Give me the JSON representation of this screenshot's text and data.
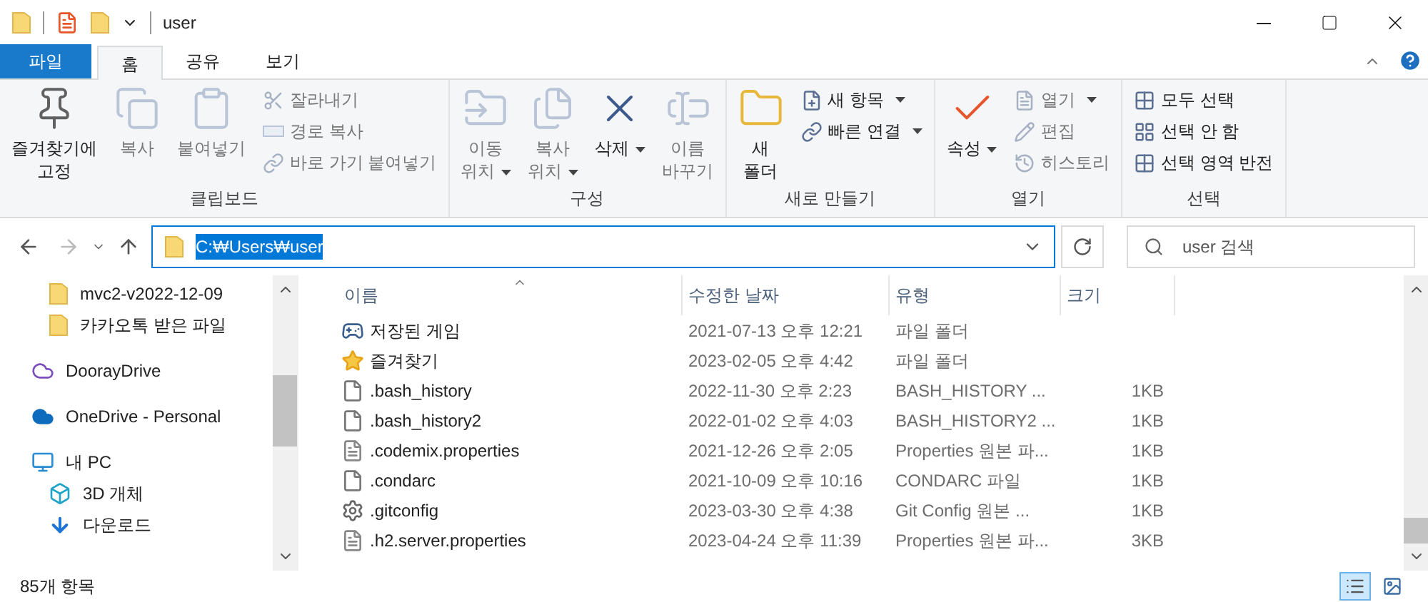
{
  "window": {
    "title": "user"
  },
  "ribbon_tabs": [
    {
      "label": "파일",
      "kind": "file",
      "selected": false
    },
    {
      "label": "홈",
      "kind": "tab",
      "selected": true
    },
    {
      "label": "공유",
      "kind": "tab",
      "selected": false
    },
    {
      "label": "보기",
      "kind": "tab",
      "selected": false
    }
  ],
  "ribbon_groups": [
    {
      "label": "클립보드",
      "items": [
        {
          "kind": "large",
          "lines": [
            "즐겨찾기에",
            "고정"
          ],
          "disabled": false,
          "dropdown": false
        },
        {
          "kind": "large",
          "lines": [
            "복사"
          ],
          "disabled": true,
          "dropdown": false
        },
        {
          "kind": "large",
          "lines": [
            "붙여넣기"
          ],
          "disabled": true,
          "dropdown": false
        },
        {
          "kind": "stack",
          "items": [
            {
              "label": "잘라내기",
              "disabled": true,
              "dropdown": false
            },
            {
              "label": "경로 복사",
              "disabled": true,
              "dropdown": false
            },
            {
              "label": "바로 가기 붙여넣기",
              "disabled": true,
              "dropdown": false
            }
          ]
        }
      ]
    },
    {
      "label": "구성",
      "items": [
        {
          "kind": "large",
          "lines": [
            "이동",
            "위치"
          ],
          "disabled": true,
          "dropdown": true
        },
        {
          "kind": "large",
          "lines": [
            "복사",
            "위치"
          ],
          "disabled": true,
          "dropdown": true
        },
        {
          "kind": "large",
          "lines": [
            "삭제"
          ],
          "disabled": false,
          "dropdown": true
        },
        {
          "kind": "large",
          "lines": [
            "이름",
            "바꾸기"
          ],
          "disabled": true,
          "dropdown": false
        }
      ]
    },
    {
      "label": "새로 만들기",
      "items": [
        {
          "kind": "large",
          "lines": [
            "새",
            "폴더"
          ],
          "disabled": false,
          "dropdown": false
        },
        {
          "kind": "stack",
          "items": [
            {
              "label": "새 항목",
              "disabled": false,
              "dropdown": true
            },
            {
              "label": "빠른 연결",
              "disabled": false,
              "dropdown": true
            }
          ]
        }
      ]
    },
    {
      "label": "열기",
      "items": [
        {
          "kind": "large",
          "lines": [
            "속성"
          ],
          "disabled": false,
          "dropdown": true
        },
        {
          "kind": "stack",
          "items": [
            {
              "label": "열기",
              "disabled": true,
              "dropdown": true
            },
            {
              "label": "편집",
              "disabled": true,
              "dropdown": false
            },
            {
              "label": "히스토리",
              "disabled": true,
              "dropdown": false
            }
          ]
        }
      ]
    },
    {
      "label": "선택",
      "items": [
        {
          "kind": "stack",
          "items": [
            {
              "label": "모두 선택",
              "disabled": false,
              "dropdown": false
            },
            {
              "label": "선택 안 함",
              "disabled": false,
              "dropdown": false
            },
            {
              "label": "선택 영역 반전",
              "disabled": false,
              "dropdown": false
            }
          ]
        }
      ]
    }
  ],
  "address": {
    "value": "C:₩Users₩user",
    "selected": true
  },
  "search": {
    "placeholder": "user 검색"
  },
  "nav": [
    {
      "label": "mvc2-v2022-12-09",
      "kind": "folder"
    },
    {
      "label": "카카오톡 받은 파일",
      "kind": "folder"
    },
    {
      "label": "DoorayDrive",
      "kind": "dooray"
    },
    {
      "label": "OneDrive - Personal",
      "kind": "onedrive"
    },
    {
      "label": "내 PC",
      "kind": "pc",
      "children": [
        {
          "label": "3D 개체",
          "kind": "cube"
        },
        {
          "label": "다운로드",
          "kind": "download"
        }
      ]
    }
  ],
  "columns": [
    "이름",
    "수정한 날짜",
    "유형",
    "크기"
  ],
  "files": [
    {
      "name": "저장된 게임",
      "date": "2021-07-13 오후 12:21",
      "type": "파일 폴더",
      "kind": "games"
    },
    {
      "name": "즐겨찾기",
      "date": "2023-02-05 오후 4:42",
      "type": "파일 폴더",
      "kind": "star"
    },
    {
      "name": ".bash_history",
      "date": "2022-11-30 오후 2:23",
      "type": "BASH_HISTORY ...",
      "size": "1KB",
      "kind": "file"
    },
    {
      "name": ".bash_history2",
      "date": "2022-01-02 오후 4:03",
      "type": "BASH_HISTORY2 ...",
      "size": "1KB",
      "kind": "file"
    },
    {
      "name": ".codemix.properties",
      "date": "2021-12-26 오후 2:05",
      "type": "Properties 원본 파...",
      "size": "1KB",
      "kind": "text"
    },
    {
      "name": ".condarc",
      "date": "2021-10-09 오후 10:16",
      "type": "CONDARC 파일",
      "size": "1KB",
      "kind": "file"
    },
    {
      "name": ".gitconfig",
      "date": "2023-03-30 오후 4:38",
      "type": "Git Config 원본 ...",
      "size": "1KB",
      "kind": "gear"
    },
    {
      "name": ".h2.server.properties",
      "date": "2023-04-24 오후 11:39",
      "type": "Properties 원본 파...",
      "size": "3KB",
      "kind": "text"
    }
  ],
  "status": {
    "count": "85개 항목"
  },
  "views": [
    {
      "kind": "details",
      "selected": true
    },
    {
      "kind": "large",
      "selected": false
    }
  ]
}
